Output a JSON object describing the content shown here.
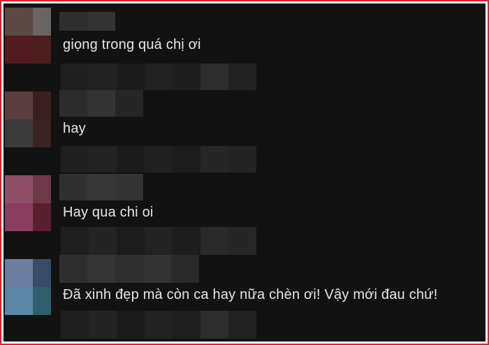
{
  "comments": [
    {
      "text": "giọng trong quá chị ơi",
      "avatar_colors": [
        "#5c4844",
        "#6a6563",
        "#521b1e",
        "#4b1e20"
      ],
      "name_blocks": [
        "#2e2e2e",
        "#333333"
      ],
      "meta_blocks": [
        "#1f1f1f",
        "#222222",
        "#1b1b1b",
        "#212121",
        "#1d1d1d",
        "#2d2d2d",
        "#222222"
      ]
    },
    {
      "text": "hay",
      "avatar_colors": [
        "#5b3f40",
        "#391f20",
        "#3a3a3a",
        "#3d2324"
      ],
      "name_blocks": [
        "#2c2c2c",
        "#333333",
        "#262626"
      ],
      "meta_blocks": [
        "#1f1f1f",
        "#222222",
        "#1b1b1b",
        "#202020",
        "#1c1c1c",
        "#262626",
        "#232323"
      ]
    },
    {
      "text": "Hay qua chi oi",
      "avatar_colors": [
        "#8e4f66",
        "#6e3a4a",
        "#8b3d60",
        "#5a1f2f"
      ],
      "name_blocks": [
        "#303030",
        "#363636",
        "#333333"
      ],
      "meta_blocks": [
        "#1e1e1e",
        "#242424",
        "#1c1c1c",
        "#222222",
        "#1d1d1d",
        "#2a2a2a",
        "#262626"
      ]
    },
    {
      "text": "Đã xinh đẹp mà còn ca hay nữa chèn ơi! Vậy mới đau chứ!",
      "avatar_colors": [
        "#6b7fa3",
        "#374d67",
        "#5b88a4",
        "#2f5e6d"
      ],
      "name_blocks": [
        "#2e2e2e",
        "#343434",
        "#2f2f2f",
        "#333333",
        "#2a2a2a"
      ],
      "meta_blocks": [
        "#1f1f1f",
        "#242424",
        "#1b1b1b",
        "#222222",
        "#1e1e1e",
        "#2d2d2d",
        "#222222"
      ]
    }
  ]
}
